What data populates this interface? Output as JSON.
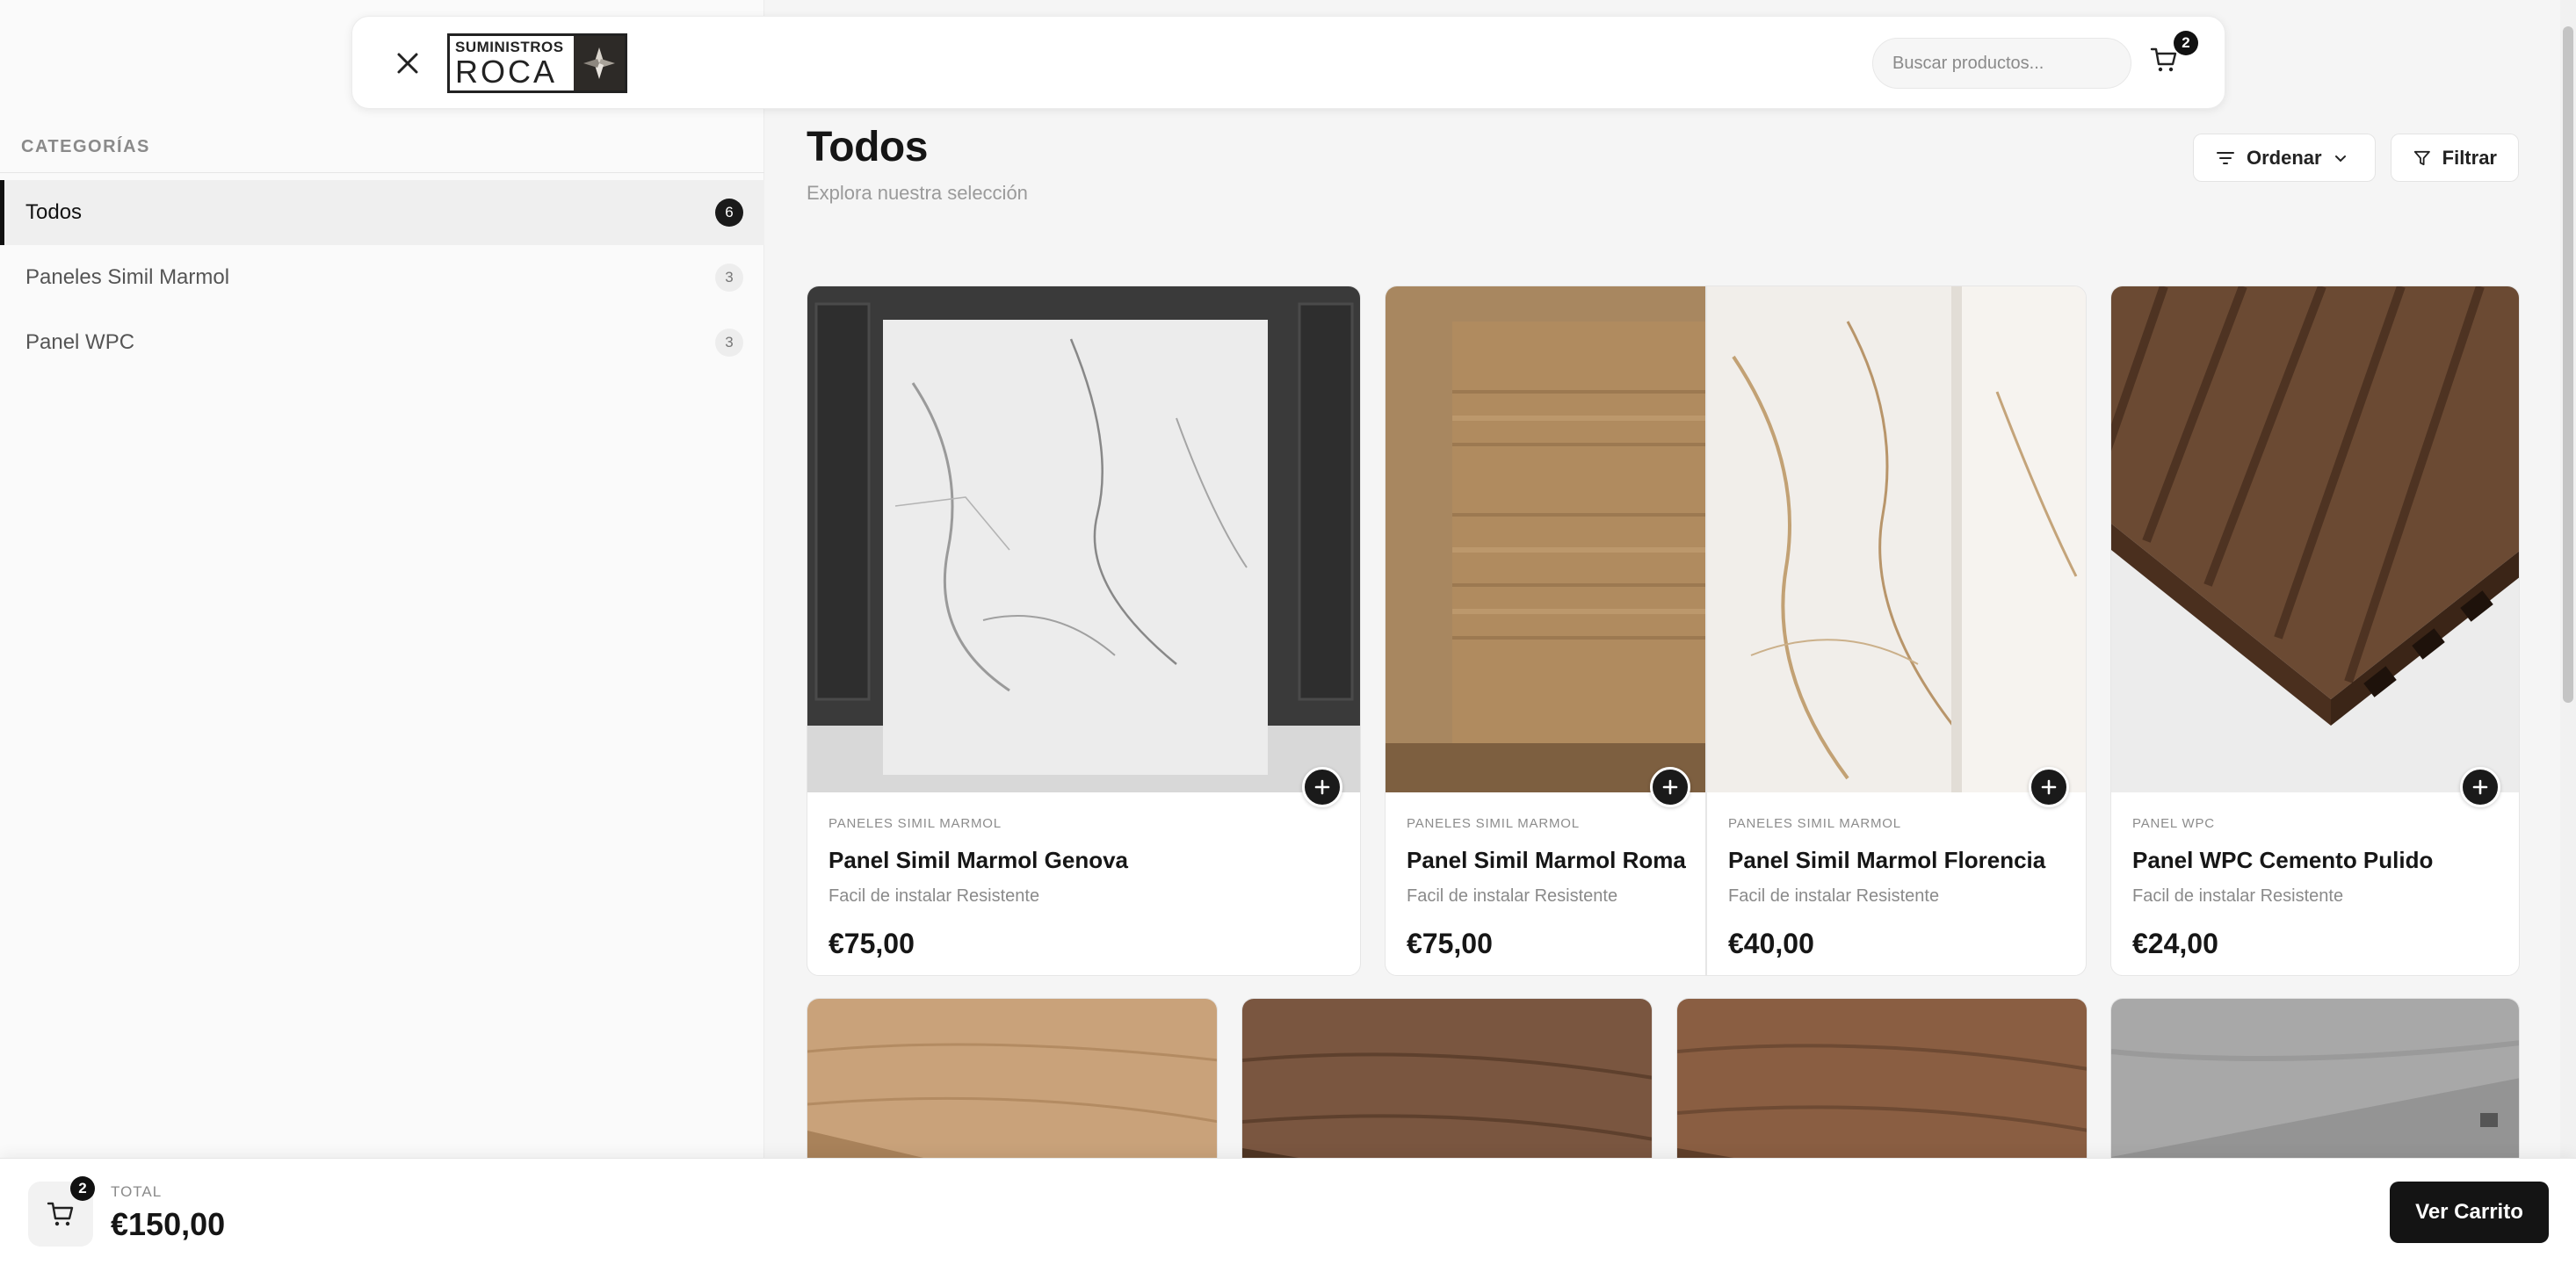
{
  "header": {
    "logo_top": "SUMINISTROS",
    "logo_bottom": "ROCA",
    "search_placeholder": "Buscar productos...",
    "cart_count": "2"
  },
  "sidebar": {
    "title": "CATEGORÍAS",
    "items": [
      {
        "label": "Todos",
        "count": "6"
      },
      {
        "label": "Paneles Simil Marmol",
        "count": "3"
      },
      {
        "label": "Panel WPC",
        "count": "3"
      }
    ]
  },
  "main": {
    "title": "Todos",
    "subtitle": "Explora nuestra selección",
    "sort_label": "Ordenar",
    "filter_label": "Filtrar"
  },
  "products": [
    {
      "category": "PANELES SIMIL MARMOL",
      "name": "Panel Simil Marmol Genova",
      "description": "Facil de instalar Resistente",
      "price": "€75,00"
    },
    {
      "category": "PANELES SIMIL MARMOL",
      "name": "Panel Simil Marmol Roma",
      "description": "Facil de instalar Resistente",
      "price": "€75,00"
    },
    {
      "category": "PANELES SIMIL MARMOL",
      "name": "Panel Simil Marmol Florencia",
      "description": "Facil de instalar Resistente",
      "price": "€40,00"
    },
    {
      "category": "PANEL WPC",
      "name": "Panel WPC Cemento Pulido",
      "description": "Facil de instalar Resistente",
      "price": "€24,00"
    }
  ],
  "bottom_bar": {
    "cart_count": "2",
    "total_label": "TOTAL",
    "total_value": "€150,00",
    "view_cart_label": "Ver Carrito"
  },
  "colors": {
    "accent": "#111111",
    "background": "#f5f5f5",
    "sidebar": "#fafafa"
  }
}
